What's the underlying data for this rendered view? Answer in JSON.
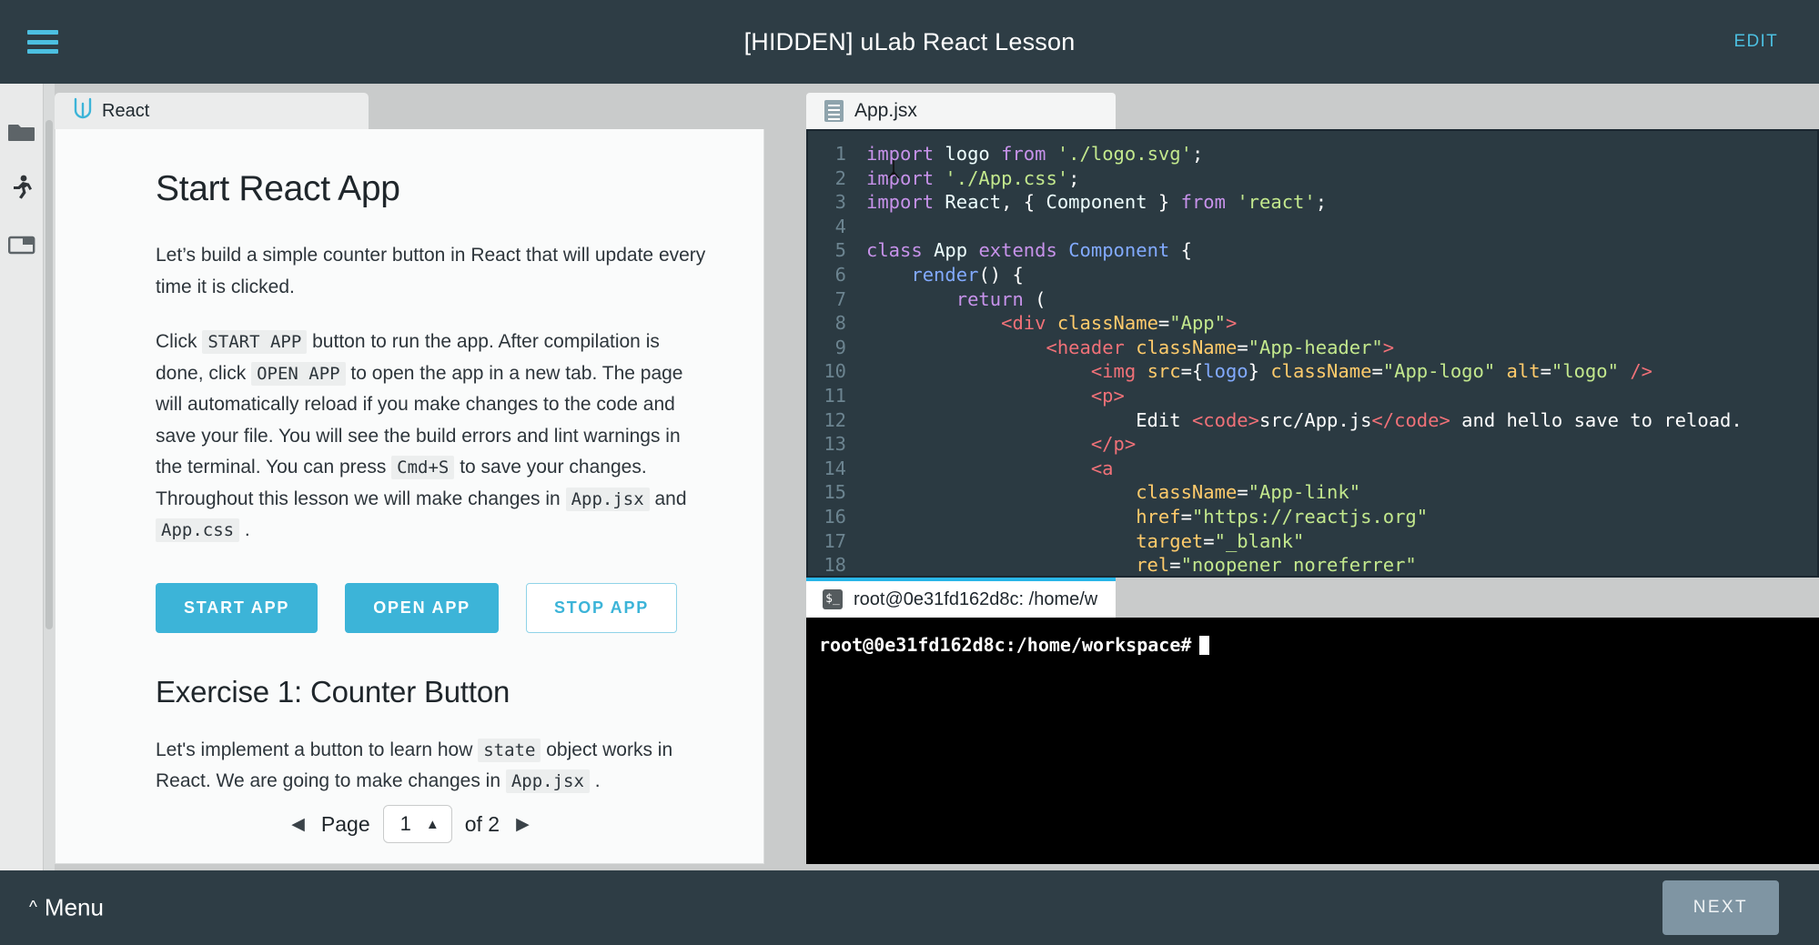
{
  "topbar": {
    "title": "[HIDDEN] uLab React Lesson",
    "edit_label": "EDIT",
    "menu_icon": "hamburger-icon"
  },
  "activitybar": {
    "items": [
      {
        "icon": "folder-filled-icon",
        "name": "files"
      },
      {
        "icon": "running-person-icon",
        "name": "run"
      },
      {
        "icon": "folder-outline-icon",
        "name": "workspace"
      }
    ]
  },
  "lesson": {
    "tab_label": "React",
    "tab_icon": "udacity-logo-icon",
    "heading": "Start React App",
    "paragraph1": "Let’s build a simple counter button in React that will update every time it is clicked.",
    "paragraph2": {
      "seg1": "Click ",
      "code1": "START APP",
      "seg2": " button to run the app. After compilation is done, click ",
      "code2": "OPEN APP",
      "seg3": " to open the app in a new tab. The page will automatically reload if you make changes to the code and save your file. You will see the build errors and lint warnings in the terminal. You can press ",
      "code3": "Cmd+S",
      "seg4": " to save your changes. Throughout this lesson we will make changes in ",
      "code4": "App.jsx",
      "seg5": " and ",
      "code5": "App.css",
      "seg6": " ."
    },
    "buttons": [
      {
        "label": "START APP",
        "style": "primary"
      },
      {
        "label": "OPEN APP",
        "style": "primary"
      },
      {
        "label": "STOP APP",
        "style": "outline"
      }
    ],
    "exercise_heading": "Exercise 1: Counter Button",
    "exercise_paragraph": {
      "seg1": "Let's implement a button to learn how ",
      "code1": "state",
      "seg2": " object works in React. We are going to make changes in ",
      "code2": "App.jsx",
      "seg3": " ."
    },
    "pagination": {
      "prev_icon": "triangle-left-icon",
      "page_label": "Page",
      "current_page": "1",
      "stepper_icon": "triangle-up-icon",
      "of_label": "of 2",
      "next_icon": "triangle-right-icon"
    }
  },
  "editor": {
    "tab_label": "App.jsx",
    "tab_icon": "file-icon",
    "lines": [
      {
        "n": "1",
        "tokens": [
          {
            "t": "import",
            "c": "k-kw"
          },
          {
            "t": " ",
            "c": "k-plain"
          },
          {
            "t": "logo",
            "c": "k-id"
          },
          {
            "t": " ",
            "c": "k-plain"
          },
          {
            "t": "from",
            "c": "k-kw"
          },
          {
            "t": " ",
            "c": "k-plain"
          },
          {
            "t": "'./logo.svg'",
            "c": "k-str"
          },
          {
            "t": ";",
            "c": "k-plain"
          }
        ]
      },
      {
        "n": "2",
        "tokens": [
          {
            "t": "import",
            "c": "k-kw"
          },
          {
            "t": " ",
            "c": "k-plain"
          },
          {
            "t": "'./App.css'",
            "c": "k-str"
          },
          {
            "t": ";",
            "c": "k-plain"
          }
        ]
      },
      {
        "n": "3",
        "tokens": [
          {
            "t": "import",
            "c": "k-kw"
          },
          {
            "t": " ",
            "c": "k-plain"
          },
          {
            "t": "React",
            "c": "k-id"
          },
          {
            "t": ", { ",
            "c": "k-plain"
          },
          {
            "t": "Component",
            "c": "k-id"
          },
          {
            "t": " } ",
            "c": "k-plain"
          },
          {
            "t": "from",
            "c": "k-kw"
          },
          {
            "t": " ",
            "c": "k-plain"
          },
          {
            "t": "'react'",
            "c": "k-str"
          },
          {
            "t": ";",
            "c": "k-plain"
          }
        ]
      },
      {
        "n": "4",
        "tokens": [
          {
            "t": "",
            "c": "k-plain"
          }
        ]
      },
      {
        "n": "5",
        "tokens": [
          {
            "t": "class",
            "c": "k-kw"
          },
          {
            "t": " ",
            "c": "k-plain"
          },
          {
            "t": "App",
            "c": "k-id"
          },
          {
            "t": " ",
            "c": "k-plain"
          },
          {
            "t": "extends",
            "c": "k-kw"
          },
          {
            "t": " ",
            "c": "k-plain"
          },
          {
            "t": "Component",
            "c": "k-type"
          },
          {
            "t": " {",
            "c": "k-plain"
          }
        ]
      },
      {
        "n": "6",
        "tokens": [
          {
            "t": "    ",
            "c": "k-plain"
          },
          {
            "t": "render",
            "c": "k-fn"
          },
          {
            "t": "() {",
            "c": "k-plain"
          }
        ]
      },
      {
        "n": "7",
        "tokens": [
          {
            "t": "        ",
            "c": "k-plain"
          },
          {
            "t": "return",
            "c": "k-kw"
          },
          {
            "t": " (",
            "c": "k-plain"
          }
        ]
      },
      {
        "n": "8",
        "tokens": [
          {
            "t": "            ",
            "c": "k-plain"
          },
          {
            "t": "<div",
            "c": "k-tag"
          },
          {
            "t": " ",
            "c": "k-plain"
          },
          {
            "t": "className",
            "c": "k-attr"
          },
          {
            "t": "=",
            "c": "k-plain"
          },
          {
            "t": "\"App\"",
            "c": "k-str"
          },
          {
            "t": ">",
            "c": "k-tag"
          }
        ]
      },
      {
        "n": "9",
        "tokens": [
          {
            "t": "                ",
            "c": "k-plain"
          },
          {
            "t": "<header",
            "c": "k-tag"
          },
          {
            "t": " ",
            "c": "k-plain"
          },
          {
            "t": "className",
            "c": "k-attr"
          },
          {
            "t": "=",
            "c": "k-plain"
          },
          {
            "t": "\"App-header\"",
            "c": "k-str"
          },
          {
            "t": ">",
            "c": "k-tag"
          }
        ]
      },
      {
        "n": "10",
        "tokens": [
          {
            "t": "                    ",
            "c": "k-plain"
          },
          {
            "t": "<img",
            "c": "k-tag"
          },
          {
            "t": " ",
            "c": "k-plain"
          },
          {
            "t": "src",
            "c": "k-attr"
          },
          {
            "t": "={",
            "c": "k-plain"
          },
          {
            "t": "logo",
            "c": "k-type"
          },
          {
            "t": "} ",
            "c": "k-plain"
          },
          {
            "t": "className",
            "c": "k-attr"
          },
          {
            "t": "=",
            "c": "k-plain"
          },
          {
            "t": "\"App-logo\"",
            "c": "k-str"
          },
          {
            "t": " ",
            "c": "k-plain"
          },
          {
            "t": "alt",
            "c": "k-attr"
          },
          {
            "t": "=",
            "c": "k-plain"
          },
          {
            "t": "\"logo\"",
            "c": "k-str"
          },
          {
            "t": " />",
            "c": "k-tag"
          }
        ]
      },
      {
        "n": "11",
        "tokens": [
          {
            "t": "                    ",
            "c": "k-plain"
          },
          {
            "t": "<p>",
            "c": "k-tag"
          }
        ]
      },
      {
        "n": "12",
        "tokens": [
          {
            "t": "                        ",
            "c": "k-plain"
          },
          {
            "t": "Edit ",
            "c": "k-plain"
          },
          {
            "t": "<code>",
            "c": "k-tag"
          },
          {
            "t": "src/App.js",
            "c": "k-plain"
          },
          {
            "t": "</code>",
            "c": "k-tag"
          },
          {
            "t": " and hello save to reload.",
            "c": "k-plain"
          }
        ]
      },
      {
        "n": "13",
        "tokens": [
          {
            "t": "                    ",
            "c": "k-plain"
          },
          {
            "t": "</p>",
            "c": "k-tag"
          }
        ]
      },
      {
        "n": "14",
        "tokens": [
          {
            "t": "                    ",
            "c": "k-plain"
          },
          {
            "t": "<a",
            "c": "k-tag"
          }
        ]
      },
      {
        "n": "15",
        "tokens": [
          {
            "t": "                        ",
            "c": "k-plain"
          },
          {
            "t": "className",
            "c": "k-attr"
          },
          {
            "t": "=",
            "c": "k-plain"
          },
          {
            "t": "\"App-link\"",
            "c": "k-str"
          }
        ]
      },
      {
        "n": "16",
        "tokens": [
          {
            "t": "                        ",
            "c": "k-plain"
          },
          {
            "t": "href",
            "c": "k-attr"
          },
          {
            "t": "=",
            "c": "k-plain"
          },
          {
            "t": "\"https://reactjs.org\"",
            "c": "k-str"
          }
        ]
      },
      {
        "n": "17",
        "tokens": [
          {
            "t": "                        ",
            "c": "k-plain"
          },
          {
            "t": "target",
            "c": "k-attr"
          },
          {
            "t": "=",
            "c": "k-plain"
          },
          {
            "t": "\"_blank\"",
            "c": "k-str"
          }
        ]
      },
      {
        "n": "18",
        "tokens": [
          {
            "t": "                        ",
            "c": "k-plain"
          },
          {
            "t": "rel",
            "c": "k-attr"
          },
          {
            "t": "=",
            "c": "k-plain"
          },
          {
            "t": "\"noopener noreferrer\"",
            "c": "k-str"
          }
        ]
      }
    ]
  },
  "terminal": {
    "tab_label": "root@0e31fd162d8c: /home/w",
    "tab_icon": "terminal-icon",
    "prompt": "root@0e31fd162d8c:/home/workspace#"
  },
  "bottombar": {
    "menu_label": "Menu",
    "menu_caret_icon": "chevron-up-icon",
    "next_label": "NEXT"
  },
  "colors": {
    "accent": "#3cb4d8",
    "topbar_bg": "#2e3d45",
    "editor_bg": "#2b3a42",
    "next_btn": "#7f95a3"
  }
}
